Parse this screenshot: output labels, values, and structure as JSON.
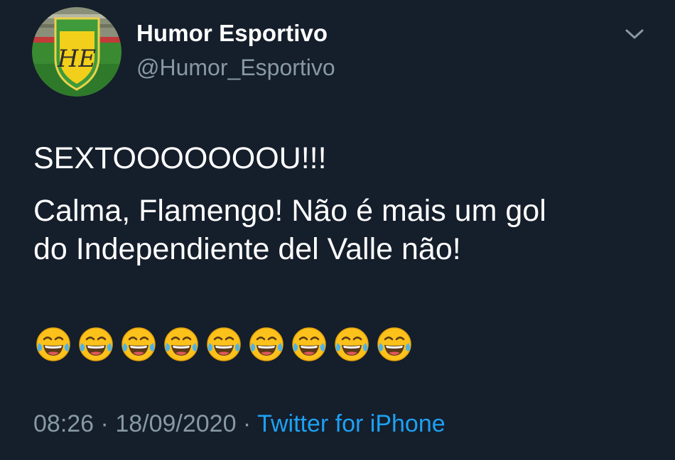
{
  "author": {
    "display_name": "Humor Esportivo",
    "handle": "@Humor_Esportivo",
    "avatar_monogram": "HE"
  },
  "icons": {
    "menu": "chevron-down-icon",
    "emoji": "face-with-tears-of-joy-icon"
  },
  "tweet": {
    "line1": "SEXTOOOOOOOU!!!",
    "line2": "Calma, Flamengo! Não é mais um gol\ndo Independiente del Valle não!",
    "emoji_count": 9
  },
  "meta": {
    "time": "08:26",
    "separator1": " · ",
    "date": "18/09/2020",
    "separator2": " · ",
    "source": "Twitter for iPhone"
  },
  "colors": {
    "background": "#151e2b",
    "text_primary": "#ffffff",
    "text_secondary": "#8899a6",
    "link": "#1da1f2",
    "crest_yellow": "#f2cf1a",
    "crest_green": "#3e9a3a"
  }
}
